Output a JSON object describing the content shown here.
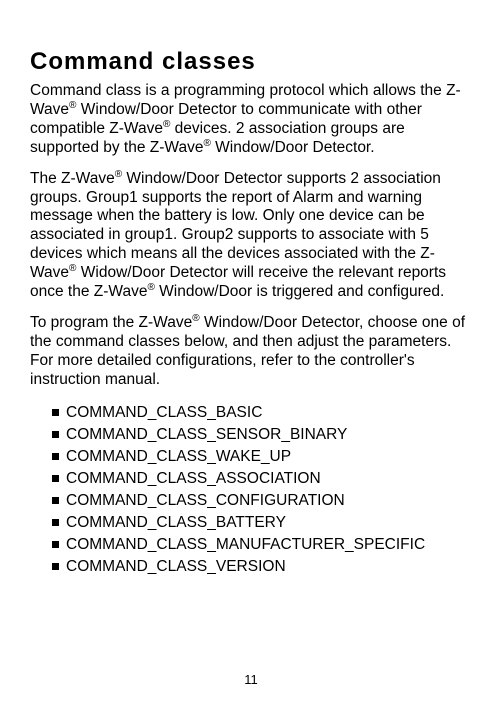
{
  "heading": "Command classes",
  "para1_a": "Command class is a programming protocol which allows the Z-Wave",
  "para1_b": " Window/Door Detector to communicate with other compatible Z-Wave",
  "para1_c": " devices. 2 association groups are supported by the Z-Wave",
  "para1_d": " Window/Door Detector.",
  "para2_a": "The Z-Wave",
  "para2_b": " Window/Door Detector supports 2 association groups. Group1 supports the report of Alarm and warning message when the battery is low. Only one device can be associated in group1. Group2 supports to associate with 5 devices which means all the devices associated with the Z-Wave",
  "para2_c": " Widow/Door Detector will receive the relevant reports once the Z-Wave",
  "para2_d": " Window/Door is triggered and configured.",
  "para3_a": "To program the Z-Wave",
  "para3_b": " Window/Door Detector, choose one of the command classes below, and then adjust the parameters. For more detailed configurations, refer to the controller's instruction manual.",
  "reg": "®",
  "items": [
    "COMMAND_CLASS_BASIC",
    "COMMAND_CLASS_SENSOR_BINARY",
    "COMMAND_CLASS_WAKE_UP",
    "COMMAND_CLASS_ASSOCIATION",
    "COMMAND_CLASS_CONFIGURATION",
    "COMMAND_CLASS_BATTERY",
    "COMMAND_CLASS_MANUFACTURER_SPECIFIC",
    "COMMAND_CLASS_VERSION"
  ],
  "page_number": "11"
}
